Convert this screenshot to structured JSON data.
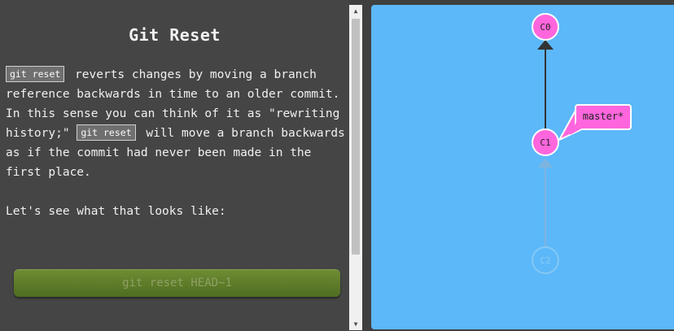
{
  "lesson": {
    "title": "Git Reset",
    "code_snippet": "git reset",
    "text_part1": "reverts changes by moving a branch reference backwards in time to an older commit. In this sense you can think of it as \"rewriting history;\"",
    "text_part2": "will move a branch backwards as if the commit had never been made in the first place.",
    "prompt_line": "Let's see what that looks like:",
    "command_button": "git reset HEAD~1"
  },
  "scrollbar": {
    "up_arrow": "▲",
    "down_arrow": "▼"
  },
  "graph": {
    "commits": [
      {
        "id": "C0",
        "state": "active"
      },
      {
        "id": "C1",
        "state": "active"
      },
      {
        "id": "C2",
        "state": "faded"
      }
    ],
    "branch_label": "master*",
    "colors": {
      "background": "#5cb8f9",
      "commit_fill": "#ff66dd",
      "edge": "#333333",
      "faded_edge": "#7fb4df"
    }
  }
}
